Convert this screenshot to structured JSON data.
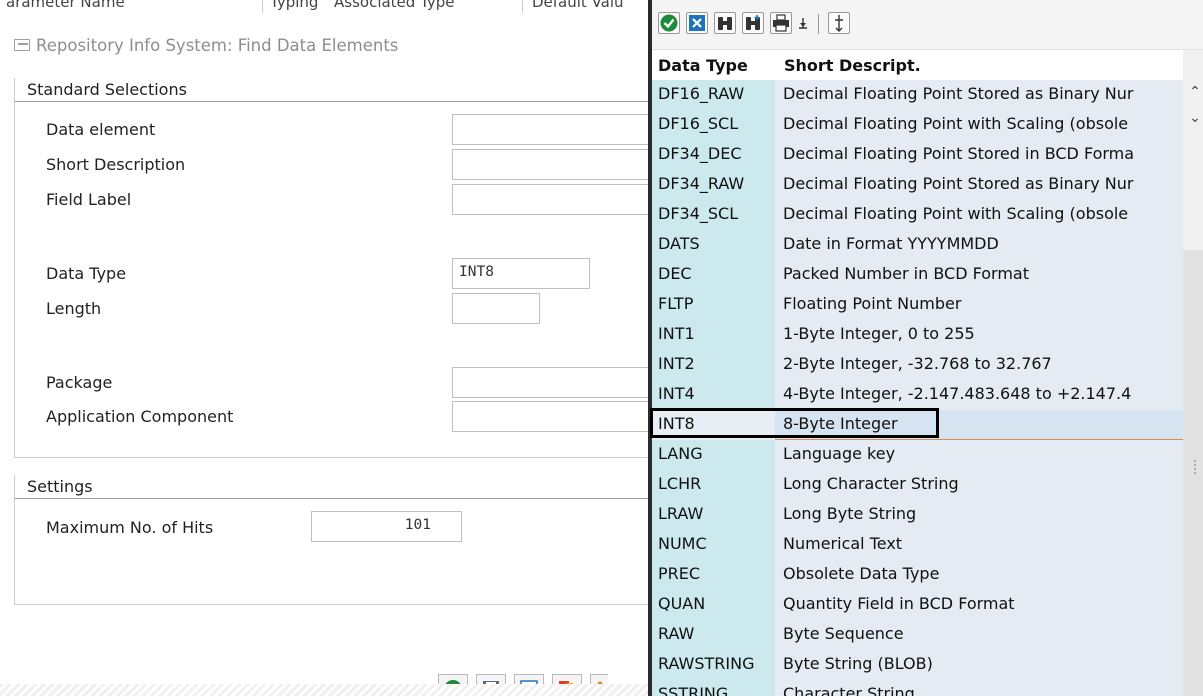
{
  "background_header": {
    "col1": "arameter Name",
    "col2": "Typing",
    "col3": "Associated Type",
    "col4": "Default Valu"
  },
  "dialog": {
    "title": "Repository Info System: Find Data Elements",
    "standard_selections": {
      "heading": "Standard Selections",
      "data_element": {
        "label": "Data element",
        "value": ""
      },
      "short_description": {
        "label": "Short Description",
        "value": ""
      },
      "field_label": {
        "label": "Field Label",
        "value": ""
      },
      "data_type": {
        "label": "Data Type",
        "value": "INT8"
      },
      "length": {
        "label": "Length",
        "value": ""
      },
      "package": {
        "label": "Package",
        "value": ""
      },
      "application_component": {
        "label": "Application Component",
        "value": ""
      }
    },
    "settings": {
      "heading": "Settings",
      "max_hits": {
        "label": "Maximum No. of Hits",
        "value": "101"
      }
    }
  },
  "value_help": {
    "columns": {
      "key": "Data Type",
      "text": "Short Descript."
    },
    "selected_key": "INT8",
    "rows": [
      {
        "key": "DF16_RAW",
        "text": "Decimal Floating Point Stored as Binary Nur"
      },
      {
        "key": "DF16_SCL",
        "text": "Decimal Floating Point with Scaling (obsole"
      },
      {
        "key": "DF34_DEC",
        "text": "Decimal Floating Point Stored in BCD Forma"
      },
      {
        "key": "DF34_RAW",
        "text": "Decimal Floating Point Stored as Binary Nur"
      },
      {
        "key": "DF34_SCL",
        "text": "Decimal Floating Point with Scaling (obsole"
      },
      {
        "key": "DATS",
        "text": "Date in Format YYYYMMDD"
      },
      {
        "key": "DEC",
        "text": "Packed Number in BCD Format"
      },
      {
        "key": "FLTP",
        "text": "Floating Point Number"
      },
      {
        "key": "INT1",
        "text": "1-Byte Integer, 0 to 255"
      },
      {
        "key": "INT2",
        "text": "2-Byte Integer, -32.768 to 32.767"
      },
      {
        "key": "INT4",
        "text": "4-Byte Integer, -2.147.483.648 to +2.147.4"
      },
      {
        "key": "INT8",
        "text": "8-Byte Integer"
      },
      {
        "key": "LANG",
        "text": "Language key"
      },
      {
        "key": "LCHR",
        "text": "Long Character String"
      },
      {
        "key": "LRAW",
        "text": "Long Byte String"
      },
      {
        "key": "NUMC",
        "text": "Numerical Text"
      },
      {
        "key": "PREC",
        "text": "Obsolete Data Type"
      },
      {
        "key": "QUAN",
        "text": "Quantity Field in BCD Format"
      },
      {
        "key": "RAW",
        "text": "Byte Sequence"
      },
      {
        "key": "RAWSTRING",
        "text": "Byte String (BLOB)"
      },
      {
        "key": "SSTRING",
        "text": "Character String"
      }
    ],
    "toolbar_icons": [
      "check-icon",
      "cancel-icon",
      "binoculars-icon",
      "find-next-icon",
      "print-icon",
      "sort-icon",
      "filter-icon"
    ]
  },
  "colors": {
    "key_column_bg": "#cce9ee",
    "text_column_bg": "#e4ebf2",
    "selected_row_bg": "#d6e4f2",
    "check_green": "#1f8a3b",
    "cancel_blue": "#1e73be"
  }
}
